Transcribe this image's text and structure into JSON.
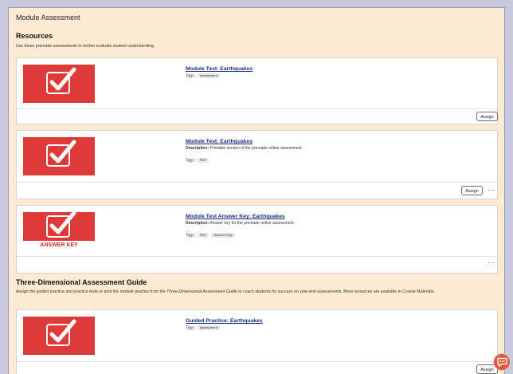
{
  "module_title": "Module Assessment",
  "resources": {
    "heading": "Resources",
    "description": "Use these premade assessments to further evaluate student understanding."
  },
  "guide": {
    "heading": "Three-Dimensional Assessment Guide",
    "desc_before": "Assign the guided practice and practice tests or print the module practice from the ",
    "desc_italic": "Three-Dimensional Assessment Guide",
    "desc_after": " to coach students for success on year-end assessments. More resources are available in Course Materials."
  },
  "cards": [
    {
      "title": "Module Test: Earthquakes",
      "tags_label": "Tags:",
      "tags": [
        "Assessment"
      ],
      "assign_label": "Assign"
    },
    {
      "title": "Module Test: Earthquakes",
      "description_label": "Description:",
      "description": "Printable version of the premade online assessment",
      "tags_label": "Tags:",
      "tags": [
        "PDF"
      ],
      "assign_label": "Assign",
      "more_label": "···"
    },
    {
      "title": "Module Test Answer Key: Earthquakes",
      "description_label": "Description:",
      "description": "Answer key for the premade online assessment.",
      "tags_label": "Tags:",
      "tags": [
        "PDF",
        "Teacher Only"
      ],
      "thumbnail_band": "ANSWER KEY",
      "more_label": "···"
    },
    {
      "title": "Guided Practice: Earthquakes",
      "tags_label": "Tags:",
      "tags": [
        "Assessment"
      ],
      "assign_label": "Assign"
    }
  ],
  "icons": {
    "thumbnail": "checkbox-check-icon",
    "help": "chat-help-icon"
  },
  "colors": {
    "thumbnail_red": "#df3a3a",
    "panel_background": "#fcebd2",
    "link_blue": "#1b2b7a",
    "help_orange": "#e05a3e"
  }
}
